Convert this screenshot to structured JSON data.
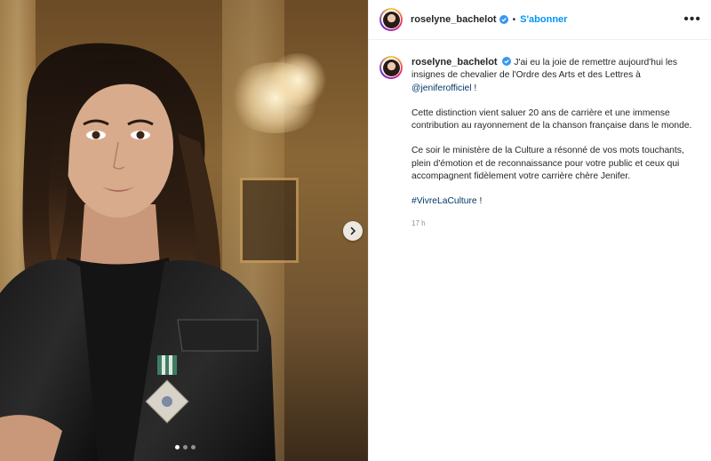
{
  "post": {
    "username": "roselyne_bachelot",
    "follow_label": "S'abonner",
    "separator": "•",
    "more_label": "•••"
  },
  "caption": {
    "username": "roselyne_bachelot",
    "line1": "J'ai eu la joie de remettre aujourd'hui les insignes de chevalier de l'Ordre des Arts et des Lettres à ",
    "mention": "@jeniferofficiel",
    "line1_end": " !",
    "paragraph2": "Cette distinction vient saluer 20 ans de carrière et une immense contribution au rayonnement de la chanson française dans le monde.",
    "paragraph3": "Ce soir le ministère de la Culture a résonné de vos mots touchants, plein d'émotion et de reconnaissance pour votre public et ceux qui accompagnent fidèlement votre carrière chère Jenifer.",
    "hashtag": "#VivreLaCulture",
    "hashtag_end": " !",
    "timestamp": "17 h"
  },
  "carousel": {
    "total": 3,
    "active_index": 0
  },
  "colors": {
    "link": "#00376b",
    "follow": "#0095f6",
    "verified": "#3897f0"
  }
}
